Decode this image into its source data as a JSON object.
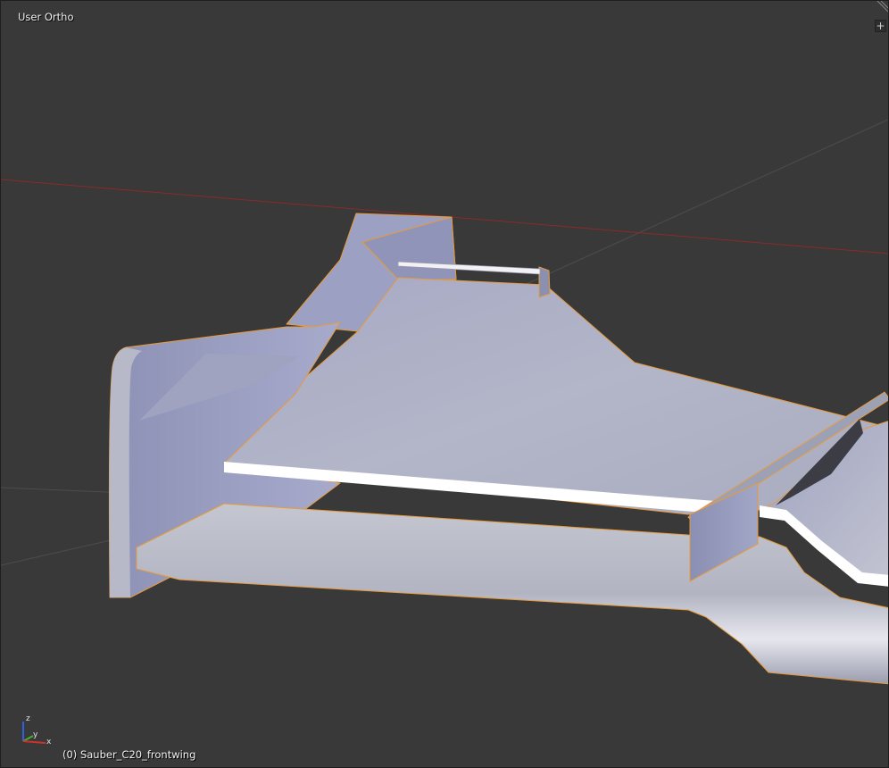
{
  "viewport": {
    "view_label": "User Ortho",
    "object_label": "(0) Sauber_C20_frontwing",
    "add_button_glyph": "+",
    "corner_widget_icon": "area-split-corner-icon",
    "add_button_icon": "plus-icon"
  },
  "axis_gizmo": {
    "z_label": "z",
    "y_label": "y",
    "x_label": "x",
    "colors": {
      "x": "#d03030",
      "y": "#40b030",
      "z": "#3060e0"
    }
  },
  "colors": {
    "background": "#393939",
    "selection_outline": "#e89a3a",
    "x_axis_line": "#8a2a2a",
    "grid_line": "#4d4d4d",
    "mesh_light": "#c8cad6",
    "mesh_dark": "#8a90b4"
  }
}
